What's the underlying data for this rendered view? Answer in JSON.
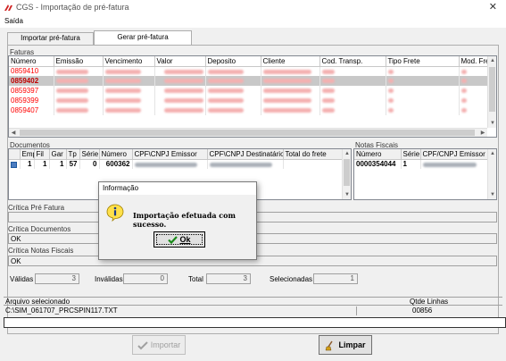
{
  "window": {
    "title": "CGS - Importação de pré-fatura",
    "close_glyph": "✕"
  },
  "menu": {
    "items": [
      "Saída"
    ]
  },
  "tabs": [
    {
      "label": "Importar pré-fatura"
    },
    {
      "label": "Gerar pré-fatura"
    }
  ],
  "faturas": {
    "label": "Faturas",
    "columns": [
      "Número",
      "Emissão",
      "Vencimento",
      "Valor",
      "Deposito",
      "Cliente",
      "Cod. Transp.",
      "Tipo Frete",
      "Mod. Frete"
    ],
    "rows": [
      {
        "numero": "0859410",
        "selected": false
      },
      {
        "numero": "0859402",
        "selected": true
      },
      {
        "numero": "0859397",
        "selected": false
      },
      {
        "numero": "0859399",
        "selected": false
      },
      {
        "numero": "0859407",
        "selected": false
      }
    ]
  },
  "documentos": {
    "label": "Documentos",
    "columns": [
      "",
      "Emp",
      "Fil",
      "Gar",
      "Tp",
      "Série",
      "Número",
      "CPF\\CNPJ Emissor",
      "CPF\\CNPJ Destinatário",
      "Total do frete"
    ],
    "rows": [
      {
        "emp": "1",
        "fil": "1",
        "gar": "1",
        "tp": "57",
        "serie": "0",
        "numero": "600362"
      }
    ]
  },
  "notas_fiscais": {
    "label": "Notas Fiscais",
    "columns": [
      "Número",
      "Série",
      "CPF/CNPJ Emissor"
    ],
    "rows": [
      {
        "numero": "0000354044",
        "serie": "1"
      }
    ]
  },
  "criticas": {
    "pre_fatura_label": "Crítica Pré Fatura",
    "pre_fatura_value": "",
    "documentos_label": "Crítica Documentos",
    "documentos_value": "OK",
    "notas_label": "Crítica Notas Fiscais",
    "notas_value": "OK"
  },
  "counters": {
    "validas_label": "Válidas",
    "validas": "3",
    "invalidas_label": "Inválidas",
    "invalidas": "0",
    "total_label": "Total",
    "total": "3",
    "selecionadas_label": "Selecionadas",
    "selecionadas": "1"
  },
  "arquivo": {
    "label": "Arquivo selecionado",
    "value": "C:\\SIM_061707_PRCSPIN117.TXT",
    "qtde_label": "Qtde Linhas",
    "qtde_value": "00856"
  },
  "buttons": {
    "importar": "Importar",
    "limpar": "Limpar"
  },
  "dialog": {
    "title": "Informação",
    "message": "Importação efetuada com sucesso.",
    "ok": "Ok"
  }
}
